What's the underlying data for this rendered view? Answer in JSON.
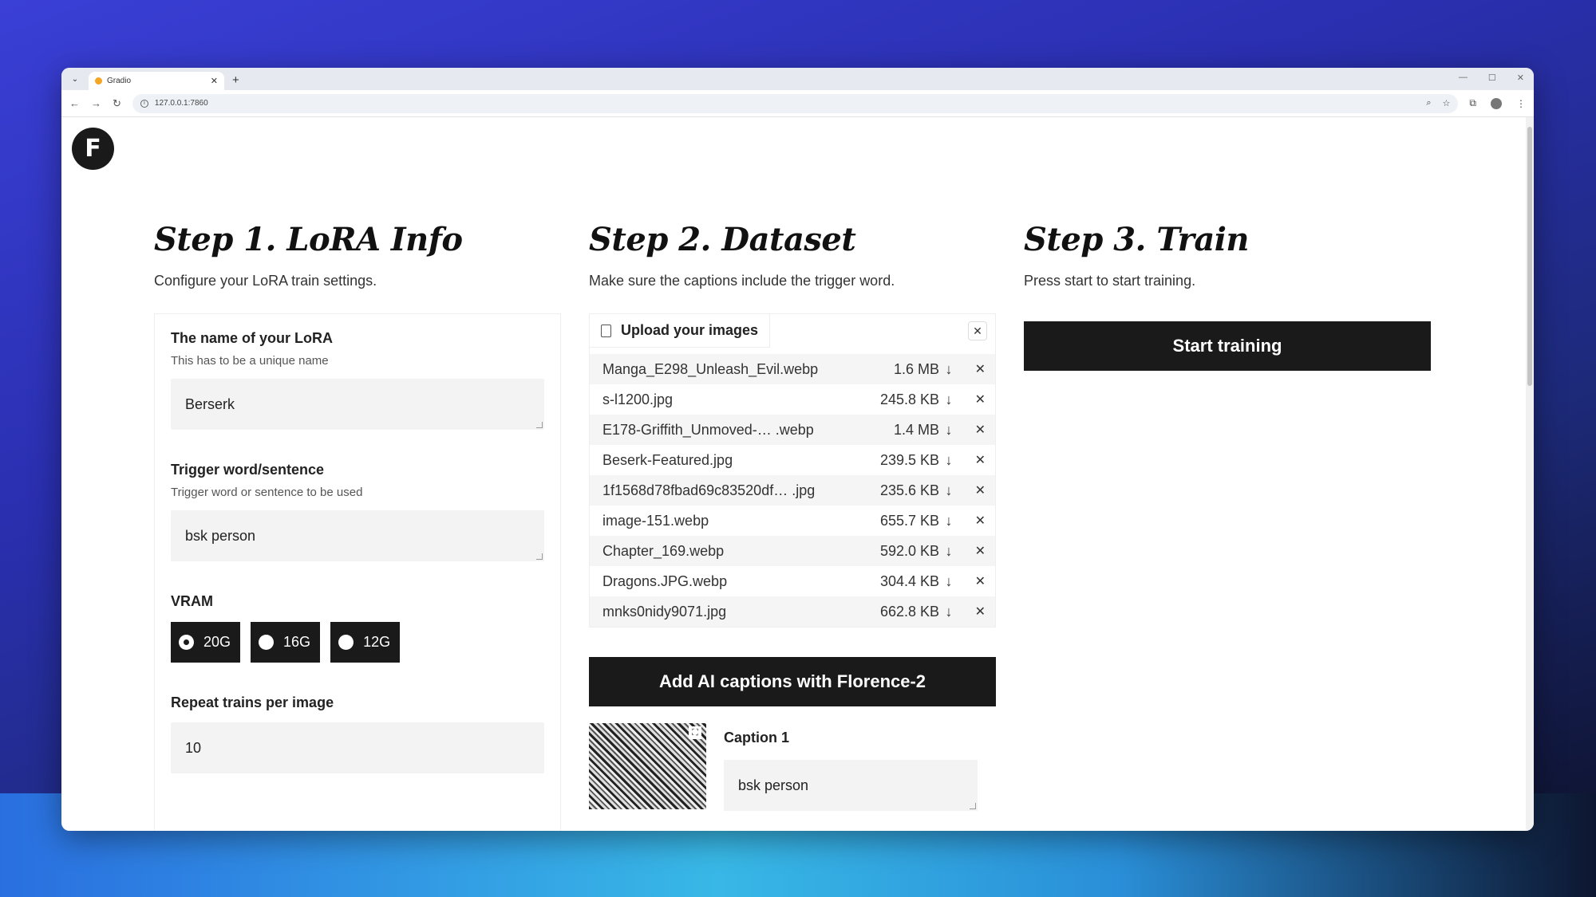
{
  "browser": {
    "tab_title": "Gradio",
    "url": "127.0.0.1:7860"
  },
  "logo": {
    "letter": "F"
  },
  "step1": {
    "title": "Step 1. LoRA Info",
    "subtitle": "Configure your LoRA train settings.",
    "name_label": "The name of your LoRA",
    "name_hint": "This has to be a unique name",
    "name_value": "Berserk",
    "trigger_label": "Trigger word/sentence",
    "trigger_hint": "Trigger word or sentence to be used",
    "trigger_value": "bsk person",
    "vram_label": "VRAM",
    "vram_options": [
      "20G",
      "16G",
      "12G"
    ],
    "vram_selected": "20G",
    "repeat_label": "Repeat trains per image",
    "repeat_value": "10"
  },
  "step2": {
    "title": "Step 2. Dataset",
    "subtitle": "Make sure the captions include the trigger word.",
    "upload_label": "Upload your images",
    "files": [
      {
        "name": "Manga_E298_Unleash_Evil.webp",
        "size": "1.6 MB"
      },
      {
        "name": "s-l1200.jpg",
        "size": "245.8 KB"
      },
      {
        "name": "E178-Griffith_Unmoved-… .webp",
        "size": "1.4 MB"
      },
      {
        "name": "Beserk-Featured.jpg",
        "size": "239.5 KB"
      },
      {
        "name": "1f1568d78fbad69c83520df… .jpg",
        "size": "235.6 KB"
      },
      {
        "name": "image-151.webp",
        "size": "655.7 KB"
      },
      {
        "name": "Chapter_169.webp",
        "size": "592.0 KB"
      },
      {
        "name": "Dragons.JPG.webp",
        "size": "304.4 KB"
      },
      {
        "name": "mnks0nidy9071.jpg",
        "size": "662.8 KB"
      }
    ],
    "ai_button": "Add AI captions with Florence-2",
    "caption_label": "Caption 1",
    "caption_value": "bsk person"
  },
  "step3": {
    "title": "Step 3. Train",
    "subtitle": "Press start to start training.",
    "start_button": "Start training"
  }
}
